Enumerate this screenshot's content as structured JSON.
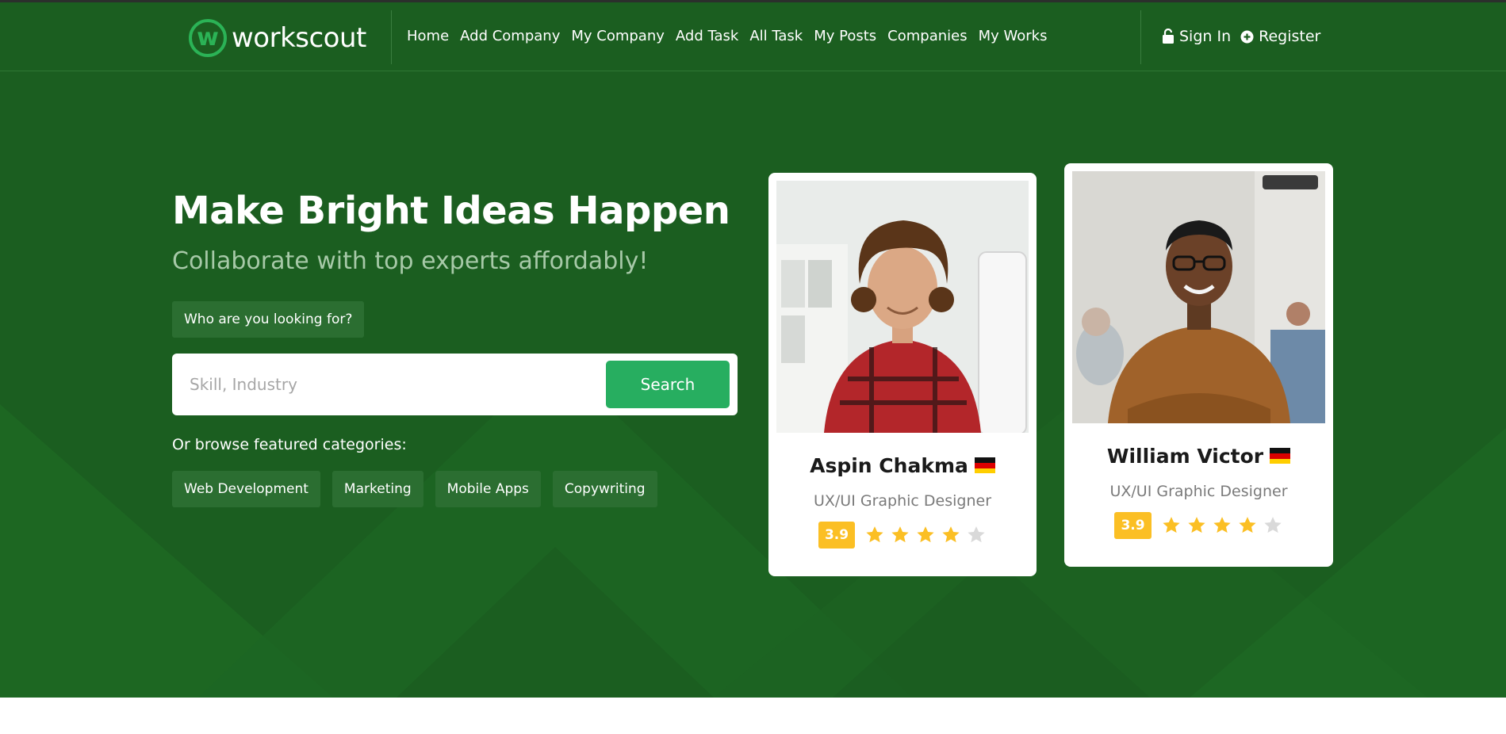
{
  "brand": {
    "logo_letter": "w",
    "name": "workscout",
    "accent": "#27ae60",
    "header_bg": "#1b5e20"
  },
  "nav": {
    "items": [
      {
        "label": "Home"
      },
      {
        "label": "Add Company"
      },
      {
        "label": "My Company"
      },
      {
        "label": "Add Task"
      },
      {
        "label": "All Task"
      },
      {
        "label": "My Posts"
      },
      {
        "label": "Companies"
      },
      {
        "label": "My Works"
      }
    ]
  },
  "auth": {
    "sign_in": {
      "label": "Sign In",
      "icon": "lock-icon"
    },
    "register": {
      "label": "Register",
      "icon": "plus-circle-icon"
    }
  },
  "hero": {
    "title": "Make Bright Ideas Happen",
    "subtitle": "Collaborate with top experts affordably!",
    "question": "Who are you looking for?",
    "search": {
      "placeholder": "Skill, Industry",
      "value": "",
      "button": "Search"
    },
    "browse_label": "Or browse featured categories:",
    "categories": [
      {
        "label": "Web Development"
      },
      {
        "label": "Marketing"
      },
      {
        "label": "Mobile Apps"
      },
      {
        "label": "Copywriting"
      }
    ]
  },
  "freelancers": [
    {
      "name": "Aspin Chakma",
      "flag": "germany-flag",
      "role": "UX/UI Graphic Designer",
      "rating": "3.9",
      "stars_filled": 4,
      "stars_total": 5
    },
    {
      "name": "William Victor",
      "flag": "germany-flag",
      "role": "UX/UI Graphic Designer",
      "rating": "3.9",
      "stars_filled": 4,
      "stars_total": 5
    }
  ],
  "colors": {
    "star_filled": "#fbbf24",
    "star_empty": "#d9d9d9",
    "chip_bg": "#2b6e31"
  }
}
